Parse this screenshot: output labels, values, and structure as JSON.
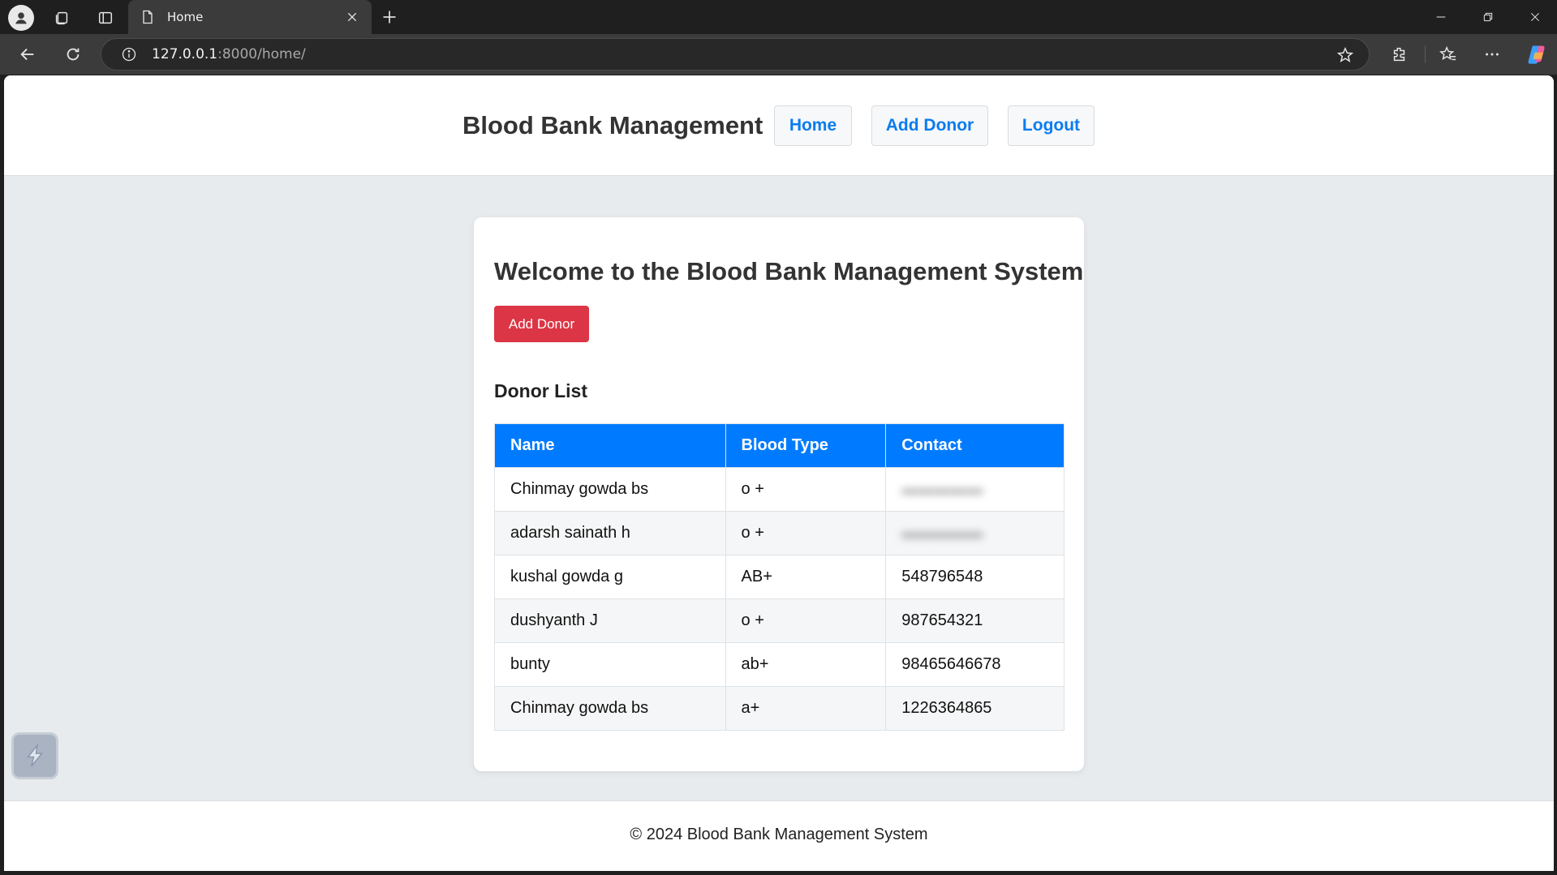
{
  "browser": {
    "tab_title": "Home",
    "url_host": "127.0.0.1",
    "url_path": ":8000/home/"
  },
  "header": {
    "brand": "Blood Bank Management",
    "nav": {
      "home": "Home",
      "add_donor": "Add Donor",
      "logout": "Logout"
    }
  },
  "main": {
    "welcome": "Welcome to the Blood Bank Management System",
    "add_donor_button": "Add Donor",
    "list_title": "Donor List",
    "table": {
      "headers": [
        "Name",
        "Blood Type",
        "Contact"
      ],
      "rows": [
        {
          "name": "Chinmay gowda bs",
          "blood_type": "o +",
          "contact": "",
          "contact_redacted": true
        },
        {
          "name": "adarsh sainath h",
          "blood_type": "o +",
          "contact": "",
          "contact_redacted": true
        },
        {
          "name": "kushal gowda g",
          "blood_type": "AB+",
          "contact": "548796548"
        },
        {
          "name": "dushyanth J",
          "blood_type": "o +",
          "contact": "987654321"
        },
        {
          "name": "bunty",
          "blood_type": "ab+",
          "contact": "98465646678"
        },
        {
          "name": "Chinmay gowda bs",
          "blood_type": "a+",
          "contact": "1226364865"
        }
      ]
    }
  },
  "footer": {
    "text": "© 2024 Blood Bank Management System"
  },
  "colors": {
    "accent_blue": "#007bff",
    "danger_red": "#dc3545",
    "page_bg": "#e8ebee"
  },
  "icons": [
    "profile-icon",
    "workspaces-icon",
    "tab-actions-icon",
    "page-icon",
    "close-icon",
    "plus-icon",
    "minimize-icon",
    "restore-icon",
    "back-icon",
    "reload-icon",
    "info-icon",
    "star-icon",
    "extensions-icon",
    "favorites-icon",
    "more-icon",
    "copilot-icon",
    "widget-icon"
  ]
}
